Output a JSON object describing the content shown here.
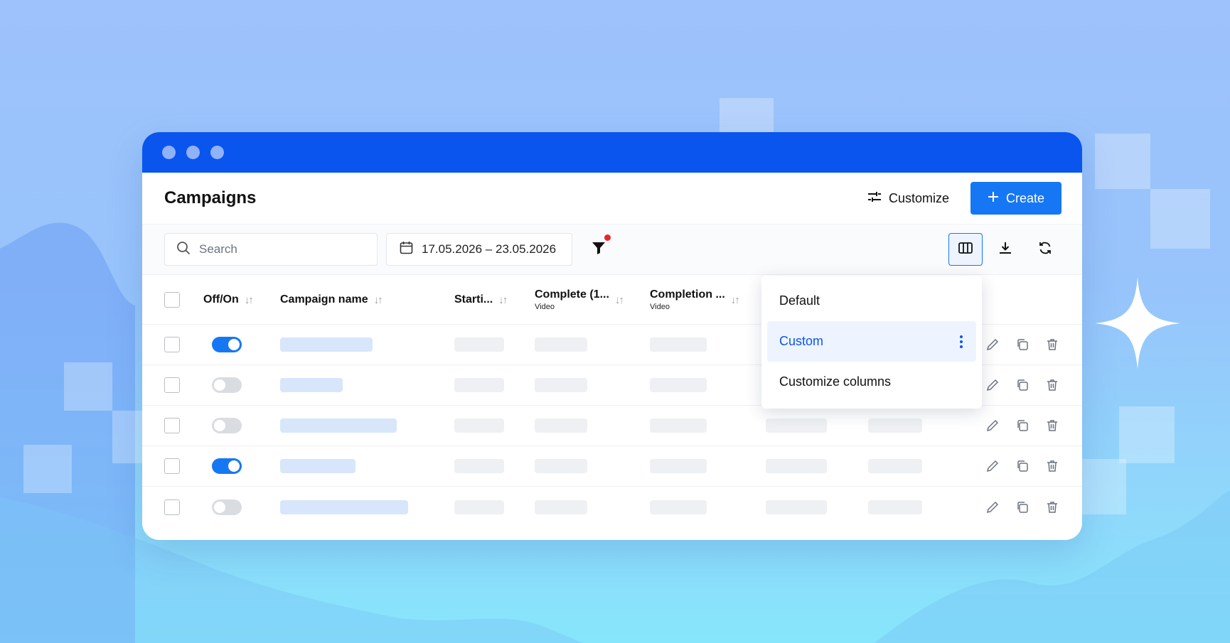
{
  "colors": {
    "accent": "#1677f5",
    "titlebar": "#0a55ee",
    "filter_badge": "#e8262f",
    "placeholder_blue": "#d7e6fb",
    "placeholder_grey": "#eef0f3"
  },
  "header": {
    "title": "Campaigns",
    "customize_label": "Customize",
    "create_label": "Create"
  },
  "toolbar": {
    "search_placeholder": "Search",
    "date_range": "17.05.2026 – 23.05.2026",
    "filter_active": true,
    "icons": [
      "columns-icon",
      "download-icon",
      "refresh-icon"
    ]
  },
  "table": {
    "columns": [
      {
        "label": "Off/On",
        "sub": ""
      },
      {
        "label": "Campaign name",
        "sub": ""
      },
      {
        "label": "Starti...",
        "sub": ""
      },
      {
        "label": "Complete (1...",
        "sub": "Video"
      },
      {
        "label": "Completion ...",
        "sub": "Video"
      }
    ],
    "rows": [
      {
        "enabled": true
      },
      {
        "enabled": false
      },
      {
        "enabled": false
      },
      {
        "enabled": true
      },
      {
        "enabled": false
      }
    ]
  },
  "columns_menu": {
    "items": [
      {
        "label": "Default",
        "selected": false
      },
      {
        "label": "Custom",
        "selected": true
      },
      {
        "label": "Customize columns",
        "selected": false
      }
    ]
  }
}
